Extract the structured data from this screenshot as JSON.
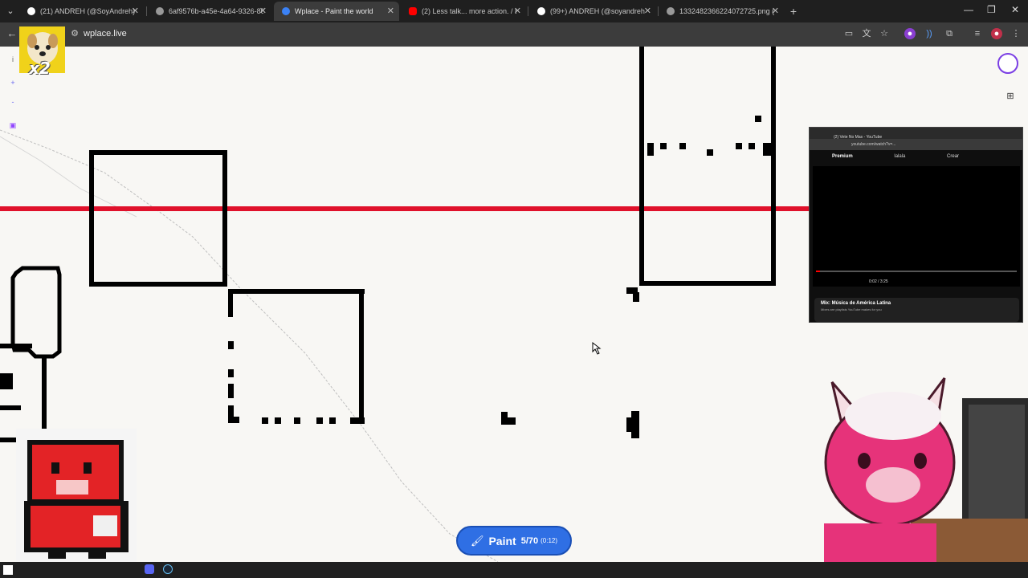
{
  "tabs": [
    {
      "title": "(21) ANDREH (@SoyAndreh) / X",
      "icon": "x-logo-icon",
      "color": "#ffffff"
    },
    {
      "title": "6af9576b-a45e-4a64-9326-805",
      "icon": "globe-icon",
      "color": "#aaaaaa"
    },
    {
      "title": "Wplace - Paint the world",
      "icon": "wplace-icon",
      "color": "#3b82f6"
    },
    {
      "title": "(2) Less talk... more action. / Lo",
      "icon": "youtube-icon",
      "color": "#ff0000"
    },
    {
      "title": "(99+) ANDREH (@soyandreh) |",
      "icon": "tiktok-icon",
      "color": "#ffffff"
    },
    {
      "title": "1332482366224072725.png (1",
      "icon": "globe-icon",
      "color": "#aaaaaa"
    }
  ],
  "address": {
    "url": "wplace.live"
  },
  "overlay": {
    "badge": "x2"
  },
  "paint_button": {
    "label": "Paint",
    "count": "5/70",
    "timer": "(0:12)"
  },
  "video_overlay": {
    "tab_title": "(2) Vete No Mas - YouTube",
    "url": "youtube.com/watch?v=...",
    "brand": "Premium",
    "search_text": "lalala",
    "create_label": "Crear",
    "time": "0:02 / 3:25",
    "mix_title": "Mix: Música de América Latina",
    "mix_sub": "Mixes are playlists YouTube makes for you"
  },
  "colors": {
    "accent_line": "#e0112b",
    "paint_button": "#2f6fe4",
    "pink_char": "#e6337a"
  }
}
